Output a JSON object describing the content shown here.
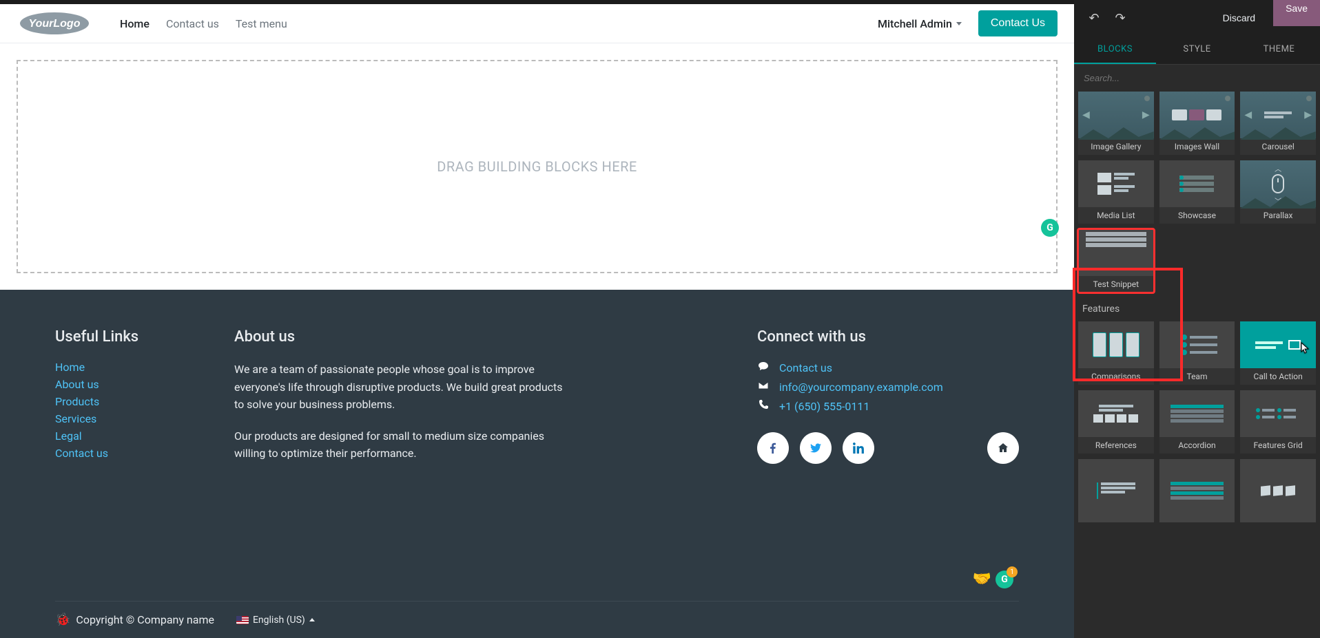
{
  "nav": {
    "logo_text": "YourLogo",
    "links": [
      "Home",
      "Contact us",
      "Test menu"
    ],
    "active_index": 0,
    "user": "Mitchell Admin",
    "contact_btn": "Contact Us"
  },
  "editor": {
    "dropzone_text": "DRAG BUILDING BLOCKS HERE"
  },
  "footer": {
    "useful_links_title": "Useful Links",
    "useful_links": [
      "Home",
      "About us",
      "Products",
      "Services",
      "Legal",
      "Contact us"
    ],
    "about_title": "About us",
    "about_p1": "We are a team of passionate people whose goal is to improve everyone's life through disruptive products. We build great products to solve your business problems.",
    "about_p2": "Our products are designed for small to medium size companies willing to optimize their performance.",
    "connect_title": "Connect with us",
    "contact_link": "Contact us",
    "email": "info@yourcompany.example.com",
    "phone": "+1 (650) 555-0111",
    "grammarly_count": "1",
    "copyright": "Copyright © Company name",
    "language": "English (US)"
  },
  "panel": {
    "discard": "Discard",
    "save": "Save",
    "tabs": [
      "BLOCKS",
      "STYLE",
      "THEME"
    ],
    "active_tab": 0,
    "search_placeholder": "Search...",
    "groups": [
      {
        "title": null,
        "snippets": [
          "Image Gallery",
          "Images Wall",
          "Carousel",
          "Media List",
          "Showcase",
          "Parallax",
          "Test Snippet"
        ]
      },
      {
        "title": "Features",
        "snippets": [
          "Comparisons",
          "Team",
          "Call to Action",
          "References",
          "Accordion",
          "Features Grid",
          "",
          "",
          ""
        ]
      }
    ],
    "highlighted_snippet": "Test Snippet",
    "hover_snippet": "Call to Action"
  }
}
